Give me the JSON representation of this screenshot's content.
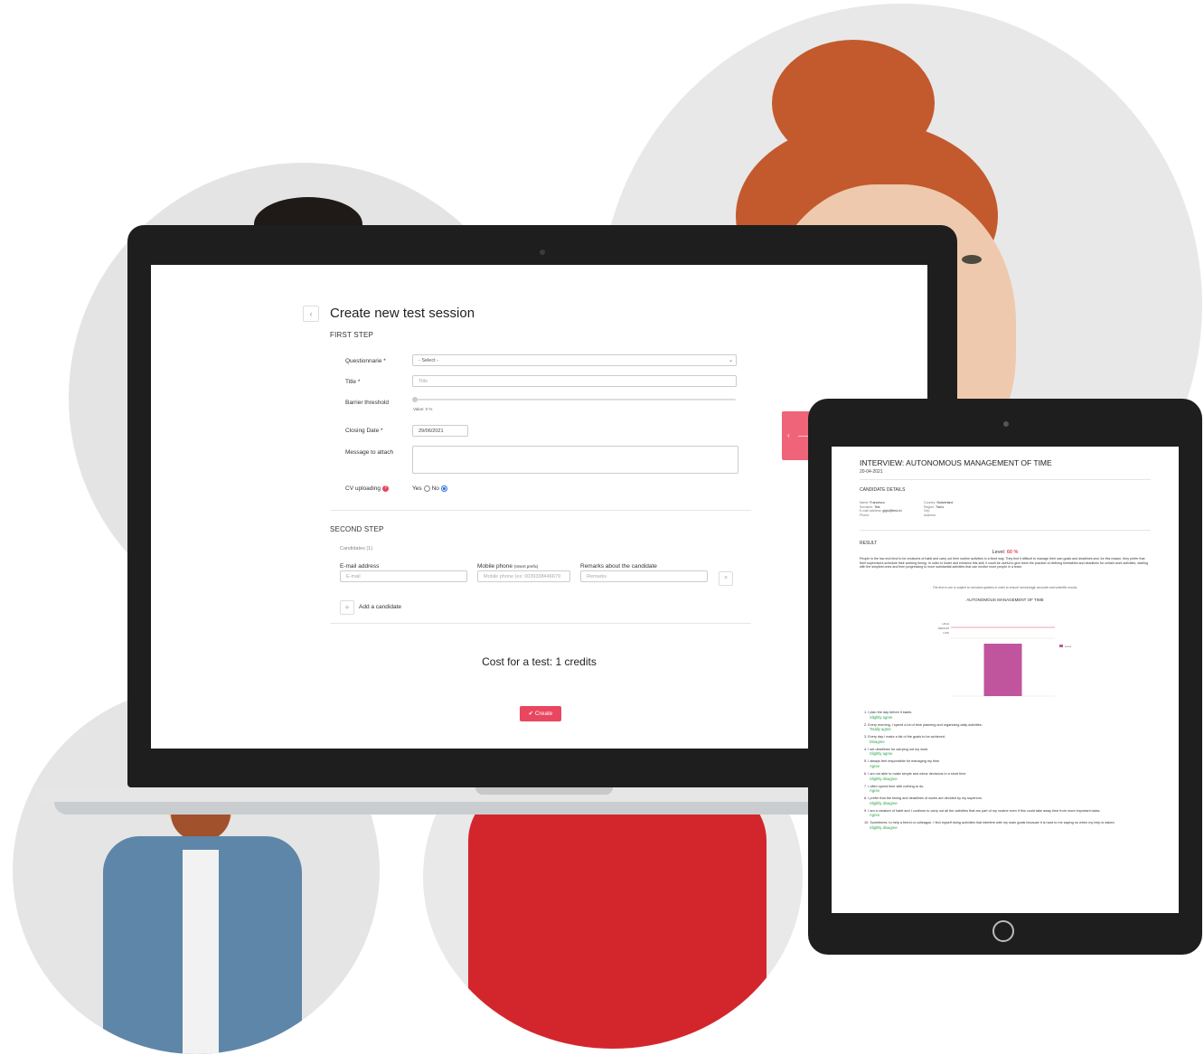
{
  "laptop": {
    "page_title": "Create new test session",
    "first_step": "FIRST STEP",
    "fields": {
      "questionnaire_label": "Questionnarie *",
      "questionnaire_value": "- Select -",
      "title_label": "Title *",
      "title_placeholder": "Title",
      "barrier_label": "Barrier threshold",
      "barrier_value_text": "Value: 0 %",
      "closing_label": "Closing Date *",
      "closing_value": "29/06/2021",
      "message_label": "Message to attach",
      "cv_label": "CV uploading",
      "cv_yes": "Yes",
      "cv_no": "No"
    },
    "second_step": "SECOND STEP",
    "candidates_count": "Candidates (1)",
    "candidate_columns": {
      "email_label": "E-mail address",
      "email_placeholder": "E-mail",
      "mobile_label": "Mobile phone",
      "mobile_hint": "(Insert prefix)",
      "mobile_placeholder": "Mobile phone (ex: 0039338446679",
      "remarks_label": "Remarks about the candidate",
      "remarks_placeholder": "Remarks"
    },
    "add_candidate": "Add a candidate",
    "cost_text": "Cost for a test: 1 credits",
    "create_button": "✔ Create"
  },
  "tablet": {
    "title": "INTERVIEW: AUTONOMOUS MANAGEMENT OF TIME",
    "date": "20-04-2021",
    "candidate_details_heading": "CANDIDATE DETAILS",
    "details_left": [
      {
        "k": "Name:",
        "v": "Francesco"
      },
      {
        "k": "Surname:",
        "v": "Test"
      },
      {
        "k": "E-mail address:",
        "v": "gigio@test.ch"
      },
      {
        "k": "Phone:",
        "v": ""
      }
    ],
    "details_right": [
      {
        "k": "Country:",
        "v": "Switzerland"
      },
      {
        "k": "Region:",
        "v": "Ticino"
      },
      {
        "k": "City:",
        "v": ""
      },
      {
        "k": "Address:",
        "v": ""
      }
    ],
    "result_heading": "RESULT",
    "level_label": "Level:",
    "level_value": "60 %",
    "paragraph": "People in the low end tend to be creatures of habit and carry out their routine activities in a fixed way. They find it difficult to manage their own goals and deadlines and, for this reason, they prefer that their supervisors schedule their working timing. In order to foster and enhance this skill, it could be useful to give them the practice of defining timetables and deadlines for certain work activities, starting with the simplest ones and then progressing to more substantial activities that can involve more people in a team.",
    "note": "The test in use is subject to constant updates in order to ensure increasingly accurate and scientific results.",
    "questions": [
      {
        "q": "1. I plan the day before it starts.",
        "a": "Slightly agree"
      },
      {
        "q": "2. Every morning, I spend a lot of time planning and organizing daily activities.",
        "a": "Totally agree"
      },
      {
        "q": "3. Every day I make a list of the goals to be achieved.",
        "a": "Disagree"
      },
      {
        "q": "4. I set deadlines for carrying out my work.",
        "a": "Slightly agree"
      },
      {
        "q": "5. I always feel responsible for managing my time",
        "a": "Agree"
      },
      {
        "q": "6. I am not able to make simple and minor decisions in a short time",
        "a": "Slightly disagree"
      },
      {
        "q": "7. I often spend time with nothing to do.",
        "a": "Agree"
      },
      {
        "q": "8. I prefer that the timing and deadlines of works are decided by my superiors.",
        "a": "Slightly disagree"
      },
      {
        "q": "9. I am a creature of habit and I continue to carry out all the activities that are part of my routine even if this could take away time from more important tasks.",
        "a": "Agree"
      },
      {
        "q": "10. Sometimes, to help a friend or colleague, I find myself doing activities that interfere with my main goals because it is hard to me saying no when my help is asked.",
        "a": "Slightly disagree"
      }
    ]
  },
  "chart_data": {
    "type": "bar",
    "title": "AUTONOMOUS MANAGEMENT OF TIME",
    "categories": [
      ""
    ],
    "series": [
      {
        "name": "score",
        "values": [
          60
        ],
        "color": "#c0559e"
      }
    ],
    "y_tick_labels": [
      "HIGH",
      "MEDIUM",
      "LOW"
    ],
    "reference_line_color": "#e8475f",
    "legend": "right"
  },
  "colors": {
    "accent": "#e8475f",
    "answer_green": "#2fa44a",
    "device_dark": "#1e1e1e"
  }
}
